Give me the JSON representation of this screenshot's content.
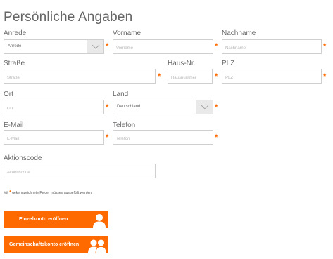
{
  "form": {
    "title": "Persönliche Angaben",
    "anrede": {
      "label": "Anrede",
      "value": "Anrede"
    },
    "vorname": {
      "label": "Vorname",
      "placeholder": "Vorname"
    },
    "nachname": {
      "label": "Nachname",
      "placeholder": "Nachname"
    },
    "strasse": {
      "label": "Straße",
      "placeholder": "Straße"
    },
    "hausnr": {
      "label": "Haus-Nr.",
      "placeholder": "Hausnummer"
    },
    "plz": {
      "label": "PLZ",
      "placeholder": "PLZ"
    },
    "ort": {
      "label": "Ort",
      "placeholder": "Ort"
    },
    "land": {
      "label": "Land",
      "value": "Deutschland"
    },
    "email": {
      "label": "E-Mail",
      "placeholder": "E-Mail"
    },
    "telefon": {
      "label": "Telefon",
      "placeholder": "Telefon"
    },
    "aktionscode": {
      "label": "Aktionscode",
      "placeholder": "Aktionscode"
    },
    "required_marker": "*",
    "note_prefix": "Mit",
    "note_suffix": "gekennzeichnete Felder müssen ausgefüllt werden"
  },
  "buttons": {
    "einzelkonto": "Einzelkonto eröffnen",
    "gemeinschaftskonto": "Gemeinschaftskonto eröffnen"
  },
  "colors": {
    "accent": "#ff6a00",
    "border": "#cfcfcf",
    "select_arrow_bg": "#e9e9e9"
  },
  "icons": {
    "select_arrow": "chevron-down-icon",
    "single_person": "person-icon",
    "two_persons": "two-persons-icon"
  }
}
